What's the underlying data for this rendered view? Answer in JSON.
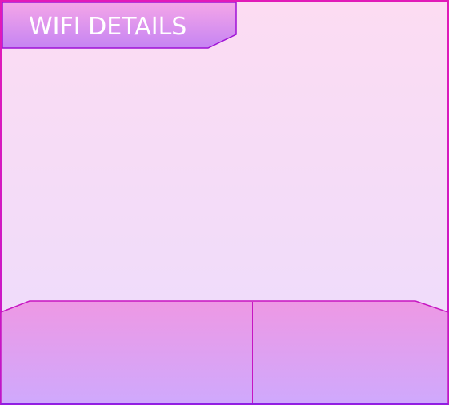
{
  "panel": {
    "title": "WIFI DETAILS"
  },
  "colors": {
    "border": "#d41cc0",
    "background_top": "#fcdcf2",
    "background_bottom": "#ecdcfd",
    "header_top": "#f28fe0",
    "header_bottom": "#c98af5",
    "header_border": "#a012d6",
    "footer_top": "#ee98e4",
    "footer_bottom": "#cfa9fd",
    "footer_border": "#c716c2",
    "bottom_edge": "#8a20e6",
    "title_text": "#ffffff"
  },
  "footer": {
    "left_action": "",
    "right_action": ""
  }
}
